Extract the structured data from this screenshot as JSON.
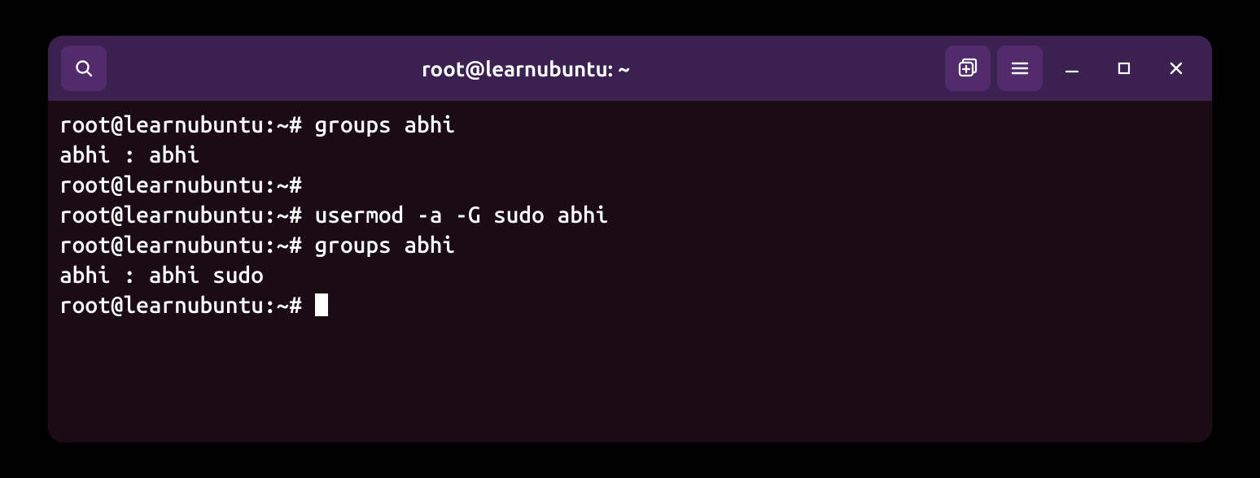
{
  "titlebar": {
    "title": "root@learnubuntu: ~"
  },
  "terminal": {
    "lines": [
      "root@learnubuntu:~# groups abhi",
      "abhi : abhi",
      "root@learnubuntu:~# ",
      "root@learnubuntu:~# usermod -a -G sudo abhi",
      "root@learnubuntu:~# groups abhi",
      "abhi : abhi sudo",
      "root@learnubuntu:~# "
    ]
  }
}
